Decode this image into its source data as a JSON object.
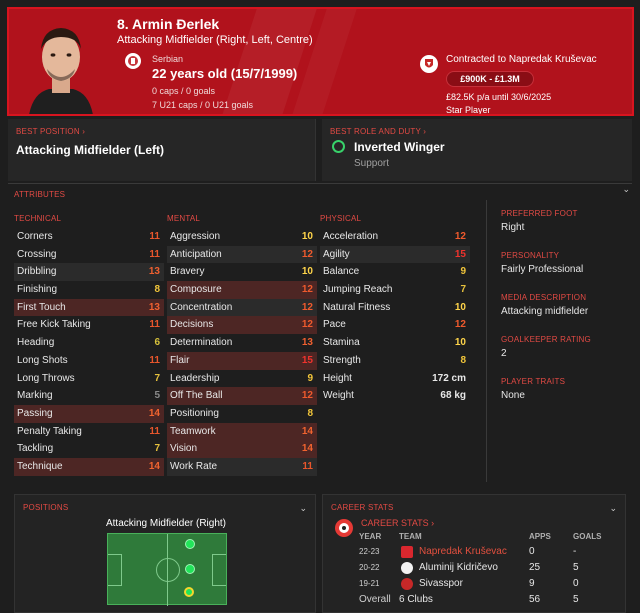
{
  "header": {
    "name": "8. Armin Đerlek",
    "positions": "Attacking Midfielder (Right, Left, Centre)",
    "nationality": "Serbian",
    "age": "22 years old (15/7/1999)",
    "caps": "0 caps / 0 goals",
    "u21_caps": "7 U21 caps / 0 U21 goals",
    "contract": "Contracted to Napredak Kruševac",
    "value": "£900K - £1.3M",
    "wage": "£82.5K p/a until 30/6/2025",
    "status": "Star Player",
    "accent": "#b1121c"
  },
  "best_position": {
    "label": "BEST POSITION ›",
    "value": "Attacking Midfielder (Left)"
  },
  "best_role": {
    "label": "BEST ROLE AND DUTY ›",
    "role": "Inverted Winger",
    "duty": "Support"
  },
  "attributes": {
    "title": "ATTRIBUTES",
    "technical": {
      "label": "TECHNICAL",
      "rows": [
        {
          "name": "Corners",
          "value": "11"
        },
        {
          "name": "Crossing",
          "value": "11"
        },
        {
          "name": "Dribbling",
          "value": "13"
        },
        {
          "name": "Finishing",
          "value": "8"
        },
        {
          "name": "First Touch",
          "value": "13"
        },
        {
          "name": "Free Kick Taking",
          "value": "11"
        },
        {
          "name": "Heading",
          "value": "6"
        },
        {
          "name": "Long Shots",
          "value": "11"
        },
        {
          "name": "Long Throws",
          "value": "7"
        },
        {
          "name": "Marking",
          "value": "5"
        },
        {
          "name": "Passing",
          "value": "14"
        },
        {
          "name": "Penalty Taking",
          "value": "11"
        },
        {
          "name": "Tackling",
          "value": "7"
        },
        {
          "name": "Technique",
          "value": "14"
        }
      ]
    },
    "mental": {
      "label": "MENTAL",
      "rows": [
        {
          "name": "Aggression",
          "value": "10"
        },
        {
          "name": "Anticipation",
          "value": "12"
        },
        {
          "name": "Bravery",
          "value": "10"
        },
        {
          "name": "Composure",
          "value": "12"
        },
        {
          "name": "Concentration",
          "value": "12"
        },
        {
          "name": "Decisions",
          "value": "12"
        },
        {
          "name": "Determination",
          "value": "13"
        },
        {
          "name": "Flair",
          "value": "15"
        },
        {
          "name": "Leadership",
          "value": "9"
        },
        {
          "name": "Off The Ball",
          "value": "12"
        },
        {
          "name": "Positioning",
          "value": "8"
        },
        {
          "name": "Teamwork",
          "value": "14"
        },
        {
          "name": "Vision",
          "value": "14"
        },
        {
          "name": "Work Rate",
          "value": "11"
        }
      ]
    },
    "physical": {
      "label": "PHYSICAL",
      "rows": [
        {
          "name": "Acceleration",
          "value": "12"
        },
        {
          "name": "Agility",
          "value": "15"
        },
        {
          "name": "Balance",
          "value": "9"
        },
        {
          "name": "Jumping Reach",
          "value": "7"
        },
        {
          "name": "Natural Fitness",
          "value": "10"
        },
        {
          "name": "Pace",
          "value": "12"
        },
        {
          "name": "Stamina",
          "value": "10"
        },
        {
          "name": "Strength",
          "value": "8"
        },
        {
          "name": "Height",
          "value": "172 cm"
        },
        {
          "name": "Weight",
          "value": "68 kg"
        }
      ]
    }
  },
  "info": {
    "foot_label": "PREFERRED FOOT",
    "foot": "Right",
    "personality_label": "PERSONALITY",
    "personality": "Fairly Professional",
    "media_label": "MEDIA DESCRIPTION",
    "media": "Attacking midfielder",
    "gk_label": "GOALKEEPER RATING",
    "gk": "2",
    "traits_label": "PLAYER TRAITS",
    "traits": "None"
  },
  "positions": {
    "label": "POSITIONS",
    "title": "Attacking Midfielder (Right)"
  },
  "career": {
    "label": "CAREER STATS",
    "selector": "CAREER STATS ›",
    "headers": {
      "year": "YEAR",
      "team": "TEAM",
      "apps": "APPS",
      "goals": "GOALS"
    },
    "rows": [
      {
        "year": "22-23",
        "team": "Napredak Kruševac",
        "apps": "0",
        "goals": "-",
        "highlight": true
      },
      {
        "year": "20-22",
        "team": "Aluminij Kidričevo",
        "apps": "25",
        "goals": "5"
      },
      {
        "year": "19-21",
        "team": "Sivasspor",
        "apps": "9",
        "goals": "0"
      }
    ],
    "total": {
      "year": "Overall",
      "team": "6 Clubs",
      "apps": "56",
      "goals": "5"
    }
  }
}
